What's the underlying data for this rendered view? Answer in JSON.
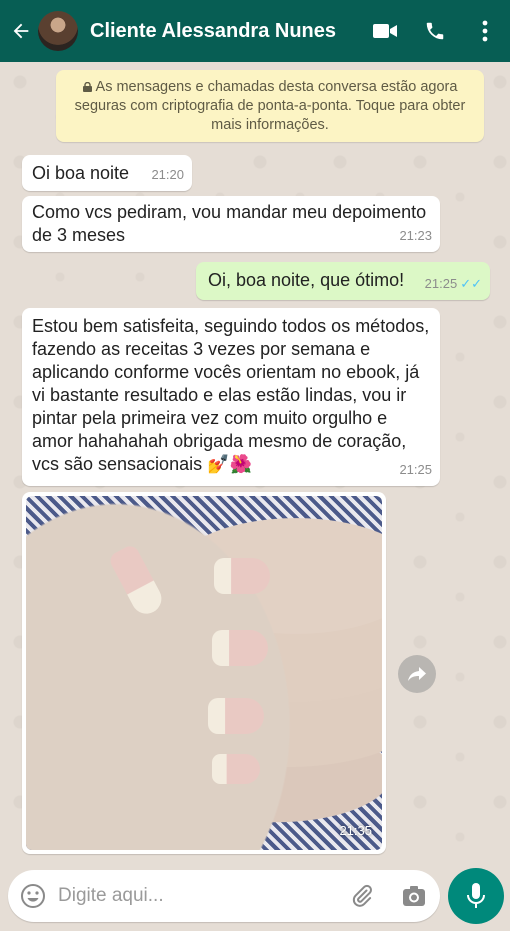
{
  "header": {
    "title": "Cliente Alessandra Nunes"
  },
  "encryption_notice": "As mensagens e chamadas desta conversa estão agora seguras com criptografia de ponta-a-ponta. Toque para obter mais informações.",
  "messages": [
    {
      "text": "Oi boa noite",
      "time": "21:20",
      "direction": "in"
    },
    {
      "text": "Como vcs pediram, vou mandar meu depoimento de 3 meses",
      "time": "21:23",
      "direction": "in"
    },
    {
      "text": "Oi, boa noite, que ótimo!",
      "time": "21:25",
      "direction": "out",
      "status": "read"
    },
    {
      "text": "Estou bem satisfeita, seguindo todos os métodos, fazendo as receitas 3 vezes por semana e aplicando conforme vocês orientam no ebook, já vi bastante resultado e elas estão lindas, vou ir pintar pela primeira vez com muito orgulho e amor hahahahah obrigada mesmo de coração, vcs são sensacionais 💅🌺",
      "time": "21:25",
      "direction": "in"
    },
    {
      "type": "image",
      "time": "21:35",
      "direction": "in"
    }
  ],
  "composer": {
    "placeholder": "Digite aqui..."
  },
  "colors": {
    "header": "#075e54",
    "outgoing_bubble": "#dcf8c6",
    "incoming_bubble": "#ffffff",
    "notice": "#fcf4c4",
    "mic_button": "#00897b",
    "read_ticks": "#4fc3f7"
  }
}
